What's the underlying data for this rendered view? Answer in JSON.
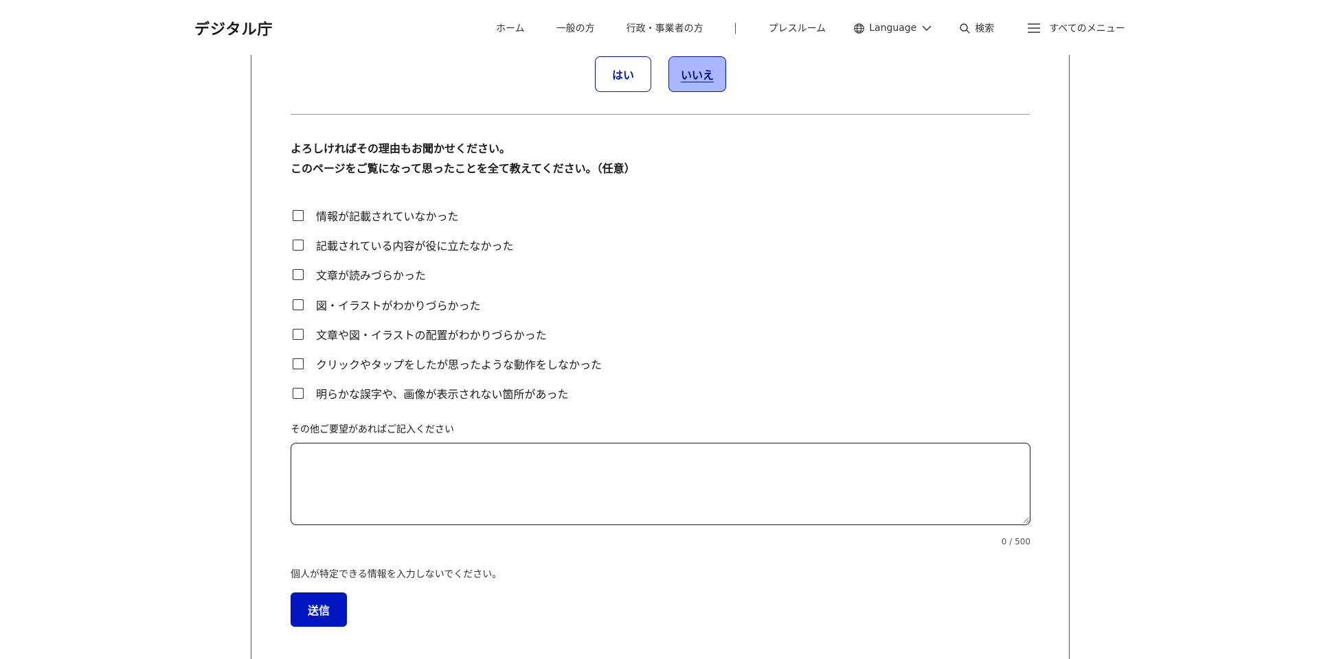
{
  "header": {
    "logo": "デジタル庁",
    "nav": [
      {
        "label": "ホーム"
      },
      {
        "label": "一般の方"
      },
      {
        "label": "行政・事業者の方"
      },
      {
        "label": "プレスルーム"
      },
      {
        "label": "Language",
        "icon": "globe-icon",
        "caret": "chevron-down-icon"
      },
      {
        "label": "検索",
        "icon": "search-icon"
      },
      {
        "label": "すべてのメニュー",
        "icon": "menu-icon"
      }
    ]
  },
  "feedback": {
    "yes_label": "はい",
    "no_label": "いいえ",
    "selected": "いいえ",
    "question_line1": "よろしければその理由もお聞かせください。",
    "question_line2": "このページをご覧になって思ったことを全て教えてください。（任意）",
    "options": [
      {
        "label": "情報が記載されていなかった",
        "checked": false
      },
      {
        "label": "記載されている内容が役に立たなかった",
        "checked": false
      },
      {
        "label": "文章が読みづらかった",
        "checked": false
      },
      {
        "label": "図・イラストがわかりづらかった",
        "checked": false
      },
      {
        "label": "文章や図・イラストの配置がわかりづらかった",
        "checked": false
      },
      {
        "label": "クリックやタップをしたが思ったような動作をしなかった",
        "checked": false
      },
      {
        "label": "明らかな誤字や、画像が表示されない箇所があった",
        "checked": false
      }
    ],
    "textarea_label": "その他ご要望があればご記入ください",
    "textarea_value": "",
    "counter": "0 / 500",
    "note": "個人が特定できる情報を入力しないでください。",
    "submit_label": "送信"
  },
  "colors": {
    "accent": "#0017c1",
    "selected_bg": "#a9b8ff",
    "text": "#1a1a1c"
  }
}
